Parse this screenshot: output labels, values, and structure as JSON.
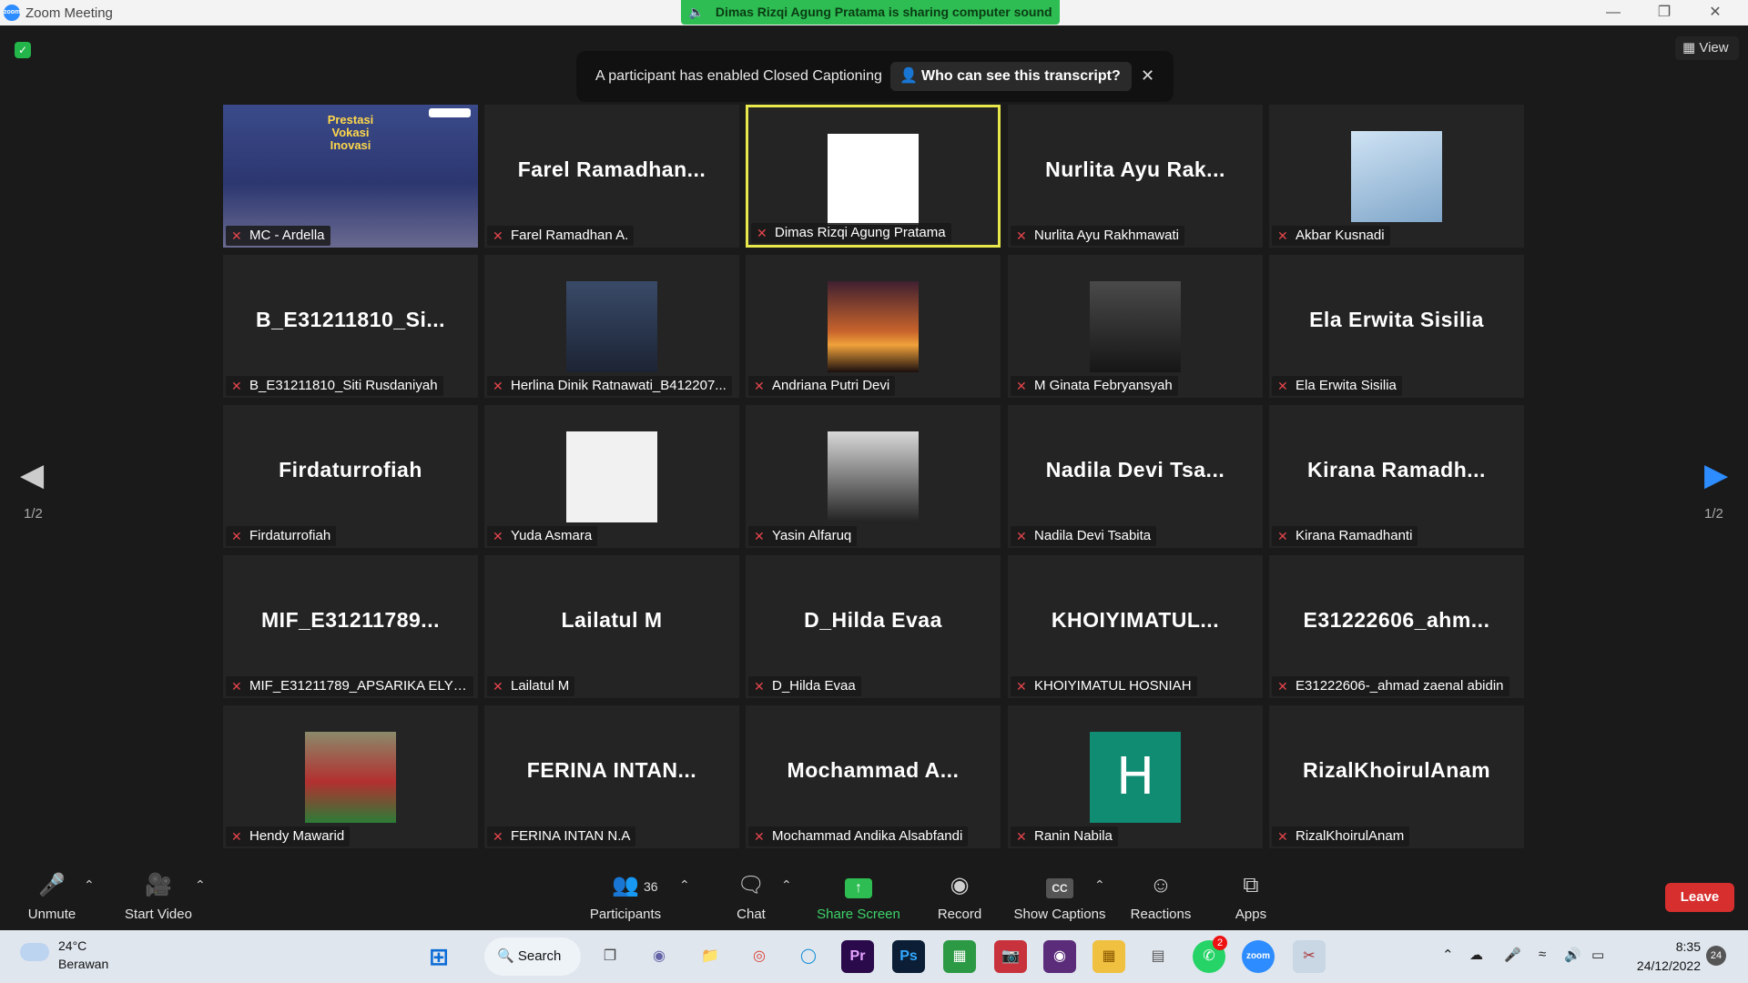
{
  "window": {
    "title": "Zoom Meeting",
    "app_icon": "zoom"
  },
  "banner": {
    "sharing": "Dimas Rizqi Agung Pratama is sharing computer sound"
  },
  "view_label": "View",
  "caption_notice": {
    "message": "A participant has enabled Closed Captioning",
    "button": "Who can see this transcript?"
  },
  "page_left": "1/2",
  "page_right": "1/2",
  "tiles": [
    {
      "big": "",
      "name": "MC - Ardella",
      "avatar": "screenshare",
      "share_title_1": "Prestasi",
      "share_title_2": "Vokasi",
      "share_title_3": "Inovasi"
    },
    {
      "big": "Farel  Ramadhan...",
      "name": "Farel Ramadhan A.",
      "avatar": ""
    },
    {
      "big": "",
      "name": "Dimas Rizqi Agung Pratama",
      "avatar": "cartoon",
      "active": true
    },
    {
      "big": "Nurlita  Ayu  Rak...",
      "name": "Nurlita Ayu Rakhmawati",
      "avatar": ""
    },
    {
      "big": "",
      "name": "Akbar Kusnadi",
      "avatar": "anime"
    },
    {
      "big": "B_E31211810_Si...",
      "name": "B_E31211810_Siti Rusdaniyah",
      "avatar": ""
    },
    {
      "big": "",
      "name": "Herlina Dinik Ratnawati_B412207...",
      "avatar": "poster"
    },
    {
      "big": "",
      "name": "Andriana Putri Devi",
      "avatar": "sunset"
    },
    {
      "big": "",
      "name": "M Ginata Febryansyah",
      "avatar": "dark"
    },
    {
      "big": "Ela Erwita Sisilia",
      "name": "Ela Erwita Sisilia",
      "avatar": ""
    },
    {
      "big": "Firdaturrofiah",
      "name": "Firdaturrofiah",
      "avatar": ""
    },
    {
      "big": "",
      "name": "Yuda Asmara",
      "avatar": "girl"
    },
    {
      "big": "",
      "name": "Yasin Alfaruq",
      "avatar": "bear"
    },
    {
      "big": "Nadila  Devi  Tsa...",
      "name": "Nadila Devi Tsabita",
      "avatar": ""
    },
    {
      "big": "Kirana  Ramadh...",
      "name": "Kirana Ramadhanti",
      "avatar": ""
    },
    {
      "big": "MIF_E31211789...",
      "name": "MIF_E31211789_APSARIKA ELYSI...",
      "avatar": ""
    },
    {
      "big": "Lailatul M",
      "name": "Lailatul M",
      "avatar": ""
    },
    {
      "big": "D_Hilda Evaa",
      "name": "D_Hilda Evaa",
      "avatar": ""
    },
    {
      "big": "KHOIYIMATUL...",
      "name": "KHOIYIMATUL HOSNIAH",
      "avatar": ""
    },
    {
      "big": "E31222606_ahm...",
      "name": "E31222606-_ahmad zaenal abidin",
      "avatar": ""
    },
    {
      "big": "",
      "name": "Hendy Mawarid",
      "avatar": "football"
    },
    {
      "big": "FERINA  INTAN...",
      "name": "FERINA INTAN N.A",
      "avatar": ""
    },
    {
      "big": "Mochammad  A...",
      "name": "Mochammad Andika Alsabfandi",
      "avatar": ""
    },
    {
      "big": "",
      "name": "Ranin Nabila",
      "avatar": "letter",
      "letter": "H"
    },
    {
      "big": "RizalKhoirulAnam",
      "name": "RizalKhoirulAnam",
      "avatar": ""
    }
  ],
  "toolbar": {
    "unmute": "Unmute",
    "start_video": "Start Video",
    "participants": "Participants",
    "participants_count": "36",
    "chat": "Chat",
    "share_screen": "Share Screen",
    "record": "Record",
    "show_captions": "Show Captions",
    "reactions": "Reactions",
    "apps": "Apps",
    "leave": "Leave",
    "cc_glyph": "CC"
  },
  "taskbar": {
    "temp": "24°C",
    "weather": "Berawan",
    "search": "Search",
    "time": "8:35",
    "date": "24/12/2022",
    "notifications": "24",
    "whatsapp_badge": "2",
    "ps": "Ps",
    "pr": "Pr"
  },
  "colors": {
    "accent_green": "#2dbd52",
    "leave_red": "#d72e2e",
    "active_border": "#e8e84c",
    "mic_muted": "#e5454c"
  }
}
